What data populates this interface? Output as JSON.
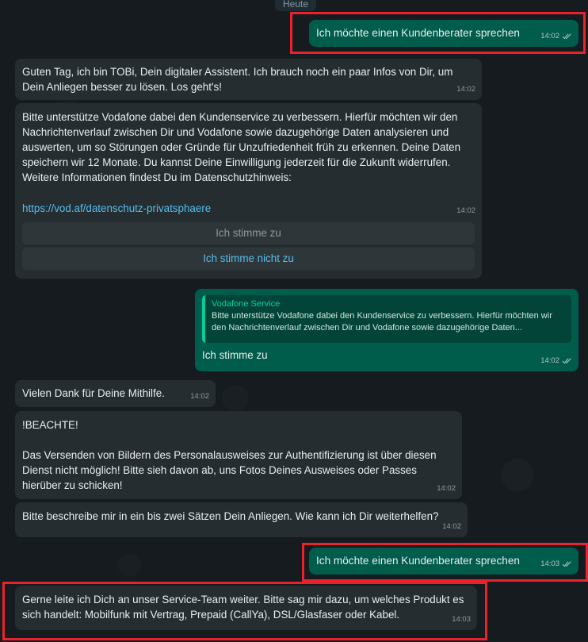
{
  "date_chip": "Heute",
  "messages": [
    {
      "id": "m1",
      "text": "Ich möchte einen Kundenberater sprechen",
      "time": "14:02"
    },
    {
      "id": "m2",
      "text": "Guten Tag, ich bin TOBi, Dein digitaler Assistent. Ich brauch noch ein paar Infos von Dir, um Dein Anliegen besser zu lösen. Los geht's!",
      "time": "14:02"
    },
    {
      "id": "m3",
      "text": "Bitte unterstütze Vodafone dabei den Kundenservice zu verbessern. Hierfür möchten wir den Nachrichtenverlauf zwischen Dir und Vodafone sowie dazugehörige Daten analysieren und auswerten, um so Störungen oder Gründe für Unzufriedenheit früh zu erkennen. Deine Daten speichern wir 12 Monate. Du kannst Deine Einwilligung jederzeit für die Zukunft widerrufen. Weitere Informationen findest Du im Datenschutzhinweis:",
      "link": "https://vod.af/datenschutz-privatsphaere",
      "time": "14:02",
      "button_accept": "Ich stimme zu",
      "button_decline": "Ich stimme nicht zu"
    },
    {
      "id": "m4",
      "quote_title": "Vodafone Service",
      "quote_text": "Bitte unterstütze Vodafone dabei den Kundenservice zu verbessern. Hierfür möchten wir den Nachrichtenverlauf zwischen Dir und Vodafone sowie dazugehörige Daten...",
      "text": "Ich stimme zu",
      "time": "14:02"
    },
    {
      "id": "m5",
      "text": "Vielen Dank für Deine Mithilfe.",
      "time": "14:02"
    },
    {
      "id": "m6",
      "text": "!BEACHTE!\n\nDas Versenden von Bildern des Personalausweises zur Authentifizierung ist über diesen Dienst nicht möglich! Bitte sieh davon ab, uns Fotos Deines Ausweises oder Passes hierüber zu schicken!",
      "time": "14:02"
    },
    {
      "id": "m7",
      "text": "Bitte beschreibe mir in ein bis zwei Sätzen Dein Anliegen. Wie kann ich Dir weiterhelfen?",
      "time": "14:02"
    },
    {
      "id": "m8",
      "text": "Ich möchte einen Kundenberater sprechen",
      "time": "14:03"
    },
    {
      "id": "m9",
      "text": "Gerne leite ich Dich an unser Service-Team weiter. Bitte sag mir dazu, um welches Produkt es sich handelt: Mobilfunk mit Vertrag, Prepaid (CallYa), DSL/Glasfaser oder Kabel.",
      "time": "14:03"
    }
  ],
  "colors": {
    "outgoing": "#005c4b",
    "incoming": "#262d31",
    "link": "#53bdeb",
    "highlight": "#e8232b"
  }
}
